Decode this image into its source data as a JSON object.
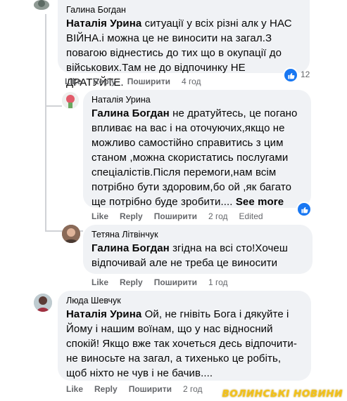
{
  "comments": [
    {
      "author": "Галина Богдан",
      "mention": "Наталія Урина",
      "text": " ситуації у всіх різні алк у НАС ВІЙНА.і можна це не виносити на загал.З повагою віднестись до тих що в окупації до військових.Там не до відпочинку НЕ ДРАТУЙТЕ.",
      "actions": {
        "like": "Like",
        "reply": "Reply",
        "share": "Поширити",
        "time": "4 год"
      },
      "reactions": "12"
    },
    {
      "author": "Наталія Урина",
      "mention": "Галина Богдан",
      "text": " не дратуйтесь, це погано впливає на вас і на оточуючих,якщо не можливо самостійно справитись з цим станом ,можна скористатись послугами спеціалістів.Після перемоги,нам всім потрібно бути здоровим,бо ой ,як багато ще потрібно буде зробити....",
      "see_more": "See more",
      "actions": {
        "like": "Like",
        "reply": "Reply",
        "share": "Поширити",
        "time": "2 год",
        "edited": "Edited"
      }
    },
    {
      "author": "Тетяна Літвінчук",
      "mention": "Галина Богдан",
      "text": " згідна на всі сто!Хочеш відпочивай але не треба це виносити",
      "actions": {
        "like": "Like",
        "reply": "Reply",
        "share": "Поширити",
        "time": "1 год"
      }
    },
    {
      "author": "Люда Шевчук",
      "mention": "Наталія Урина",
      "text": " Ой, не гнівіть Бога і дякуйте і Йому і нашим воїнам, що у нас відносний спокій! Якщо вже так хочеться десь відпочити-не виносьте на загал, а тихенько це робіть, щоб ніхто не чув і не бачив....",
      "actions": {
        "like": "Like",
        "reply": "Reply",
        "share": "Поширити",
        "time": "2 год"
      }
    }
  ],
  "watermark": "ВОЛИНСЬКІ НОВИНИ",
  "colors": {
    "accent": "#1877f2",
    "bubble": "#f0f2f5",
    "muted": "#65676b",
    "watermark": "#f3c21a"
  }
}
